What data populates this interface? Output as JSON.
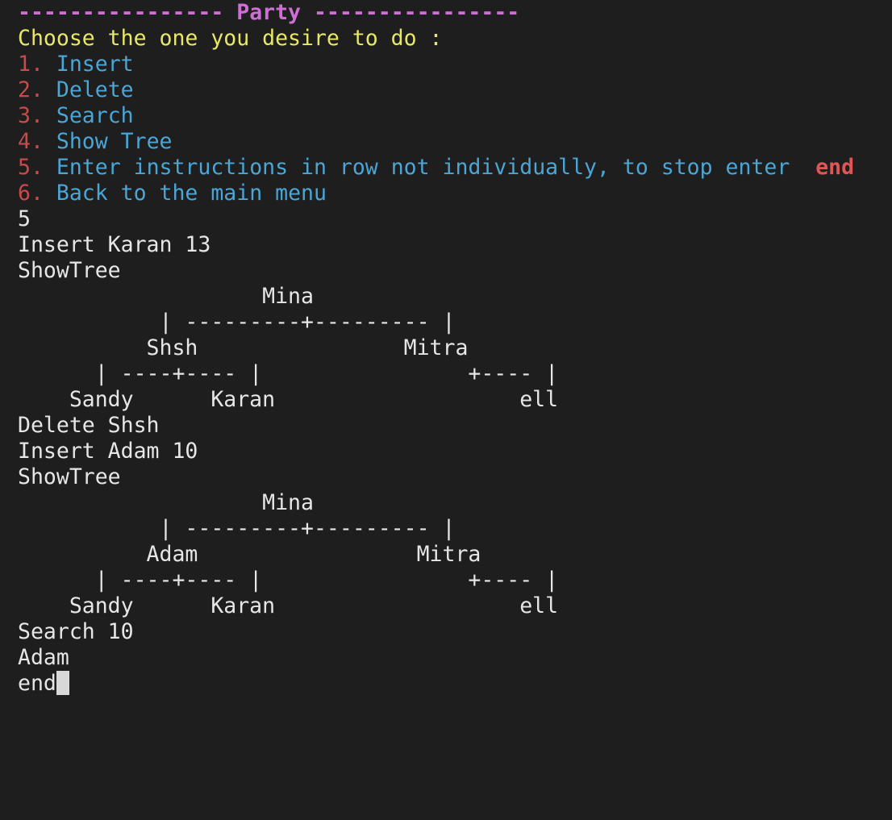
{
  "menu": {
    "header_left": "---------------- ",
    "header_title": "Party",
    "header_right": " ----------------",
    "prompt": "Choose the one you desire to do :",
    "options": [
      {
        "num": "1.",
        "label": "Insert"
      },
      {
        "num": "2.",
        "label": "Delete"
      },
      {
        "num": "3.",
        "label": "Search"
      },
      {
        "num": "4.",
        "label": "Show Tree"
      },
      {
        "num": "5.",
        "label": "Enter instructions in row not individually, to stop enter"
      },
      {
        "num": "6.",
        "label": "Back to the main menu"
      }
    ],
    "stop_keyword": "end"
  },
  "session": {
    "lines_1": [
      "5",
      "Insert Karan 13",
      "ShowTree"
    ],
    "tree_1": [
      "                   Mina",
      "           | ---------+--------- |",
      "          Shsh                Mitra",
      "      | ----+---- |                +---- |",
      "    Sandy      Karan                   ell"
    ],
    "lines_2": [
      "Delete Shsh",
      "Insert Adam 10",
      "ShowTree"
    ],
    "tree_2": [
      "                   Mina",
      "           | ---------+--------- |",
      "          Adam                 Mitra",
      "      | ----+---- |                +---- |",
      "    Sandy      Karan                   ell"
    ],
    "lines_3": [
      "Search 10",
      "Adam"
    ],
    "current_input": "end"
  },
  "colors": {
    "background": "#1e1e1e",
    "header": "#cf6ed5",
    "prompt": "#e8e866",
    "option_number": "#c94a4a",
    "option_label": "#4aa6d6",
    "keyword": "#e25555",
    "text": "#e6e6e6"
  }
}
